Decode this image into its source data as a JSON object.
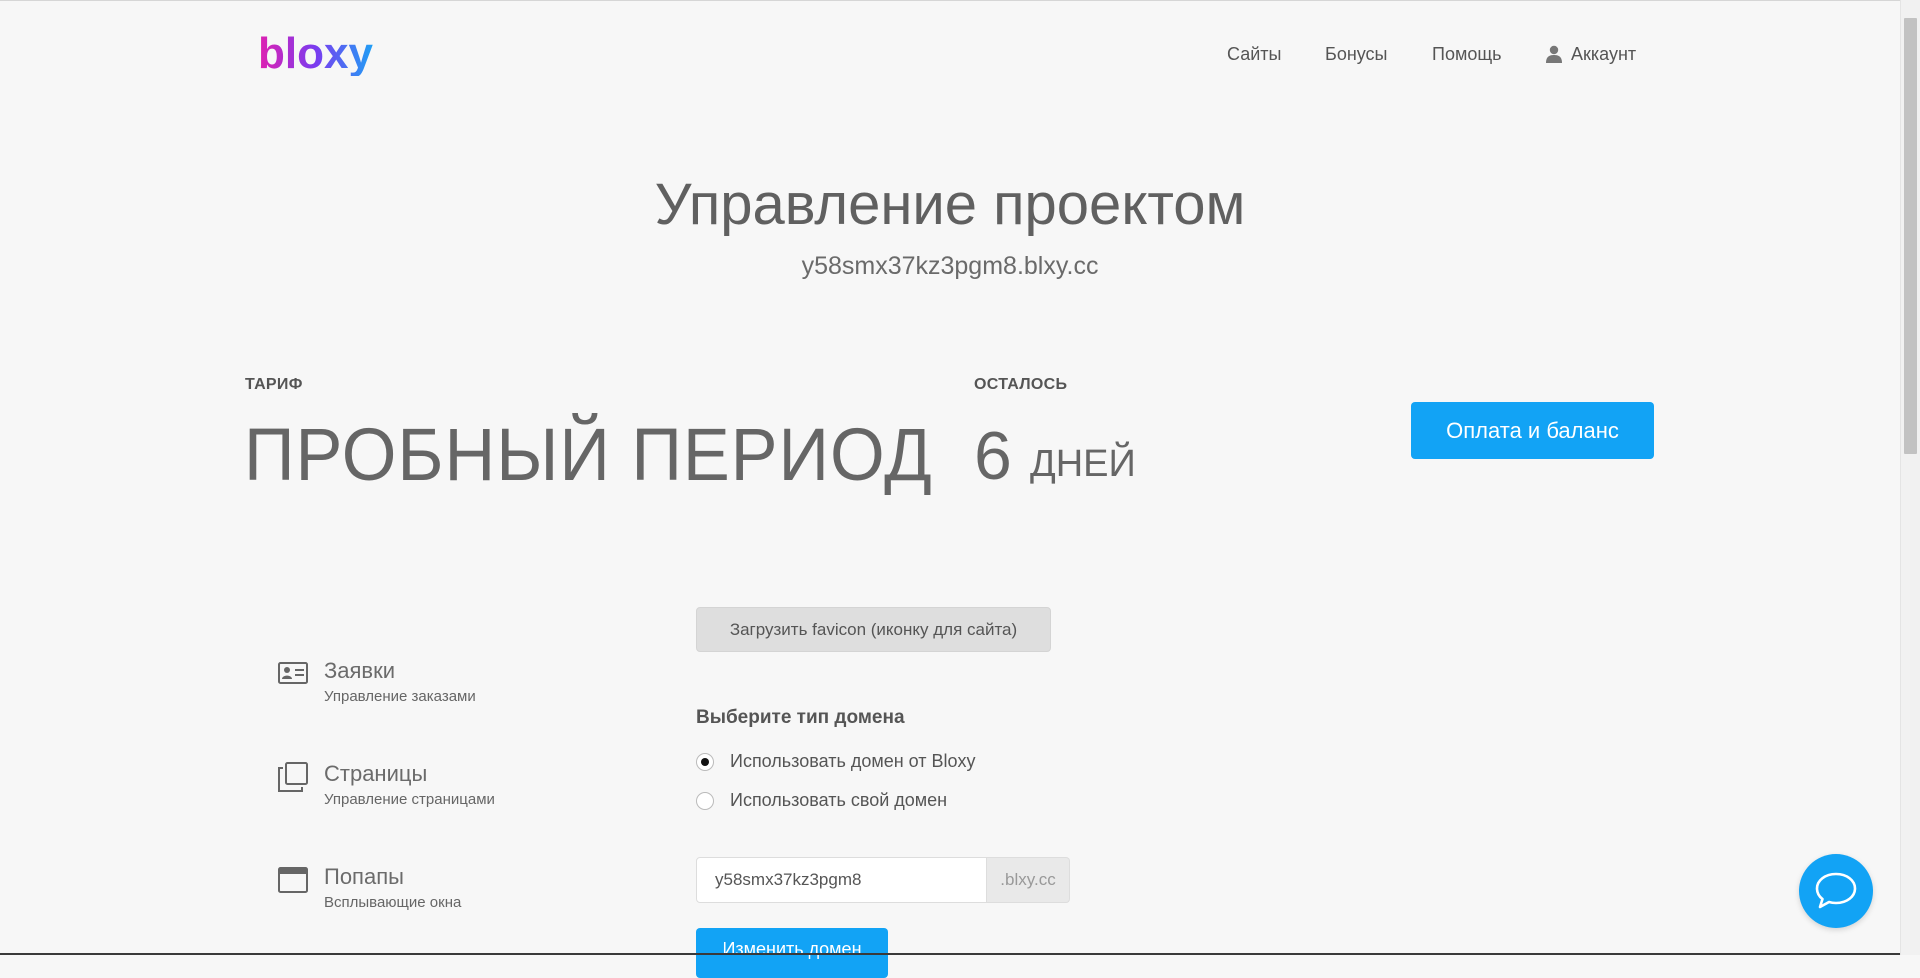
{
  "header": {
    "logo_text": "bloxy",
    "nav": {
      "sites": "Сайты",
      "bonuses": "Бонусы",
      "help": "Помощь",
      "account": "Аккаунт"
    }
  },
  "project": {
    "title": "Управление проектом",
    "domain": "y58smx37kz3pgm8.blxy.cc"
  },
  "plan": {
    "tariff_label": "ТАРИФ",
    "tariff_value": "ПРОБНЫЙ ПЕРИОД",
    "remaining_label": "ОСТАЛОСЬ",
    "remaining_number": "6",
    "remaining_unit": "ДНЕЙ",
    "pay_button": "Оплата и баланс"
  },
  "sidebar": {
    "items": [
      {
        "title": "Заявки",
        "subtitle": "Управление заказами",
        "icon": "contact-card-icon"
      },
      {
        "title": "Страницы",
        "subtitle": "Управление страницами",
        "icon": "pages-icon"
      },
      {
        "title": "Попапы",
        "subtitle": "Всплывающие окна",
        "icon": "popup-window-icon"
      }
    ]
  },
  "settings": {
    "favicon_button": "Загрузить favicon (иконку для сайта)",
    "domain_type_heading": "Выберите тип домена",
    "domain_options": [
      {
        "label": "Использовать домен от Bloxy",
        "selected": true
      },
      {
        "label": "Использовать свой домен",
        "selected": false
      }
    ],
    "domain_input_value": "y58smx37kz3pgm8",
    "domain_suffix": ".blxy.cc",
    "change_domain_button": "Изменить домен"
  },
  "colors": {
    "accent": "#12a3f5",
    "background": "#f7f7f7",
    "logo_gradient": [
      "#e020b0",
      "#7a3cf0",
      "#1fa0f5"
    ]
  }
}
